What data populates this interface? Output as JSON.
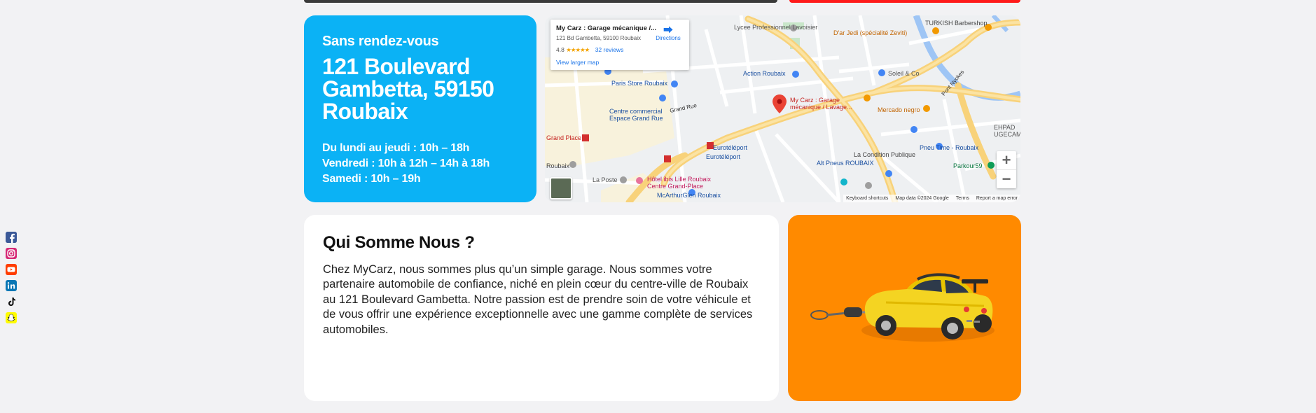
{
  "colors": {
    "info_card_bg": "#0bb2f5",
    "car_card_bg": "#ff8a00",
    "page_bg": "#f2f2f4"
  },
  "social": [
    {
      "name": "facebook-icon"
    },
    {
      "name": "instagram-icon"
    },
    {
      "name": "youtube-icon"
    },
    {
      "name": "linkedin-icon"
    },
    {
      "name": "tiktok-icon"
    },
    {
      "name": "snapchat-icon"
    }
  ],
  "info": {
    "subtitle": "Sans rendez-vous",
    "address": "121 Boulevard Gambetta, 59150 Roubaix",
    "hours": [
      "Du lundi au jeudi : 10h – 18h",
      "Vendredi : 10h à 12h – 14h à 18h",
      "Samedi : 10h – 19h"
    ]
  },
  "map": {
    "place_name": "My Carz : Garage mécanique /...",
    "place_address": "121 Bd Gambetta, 59100 Roubaix",
    "rating": "4.8",
    "stars": "★★★★★",
    "reviews": "32 reviews",
    "directions": "Directions",
    "larger_map": "View larger map",
    "zoom_in": "+",
    "zoom_out": "−",
    "footer": [
      "Keyboard shortcuts",
      "Map data ©2024 Google",
      "Terms",
      "Report a map error"
    ],
    "labels": {
      "lycee": "Lycee Professionnel Lavoisier",
      "jedi": "D'ar Jedi (spécialité Zeviti)",
      "turkish": "TURKISH Barbershop",
      "paris_store": "Paris Store Roubaix",
      "action": "Action Roubaix",
      "soleil": "Soleil & Co",
      "mycarz": "My Carz : Garage mécanique / Lavage...",
      "mercado": "Mercado negro",
      "centre": "Centre commercial Espace Grand Rue",
      "grand_place": "Grand Place",
      "euroteleport": "Eurotéléport",
      "pneu": "Pneu Time - Roubaix",
      "condition": "La Condition Publique",
      "parkour": "Parkour59",
      "alt_pneus": "Alt Pneus ROUBAIX",
      "la_poste": "La Poste",
      "ibis": "Hôtel ibis Lille Roubaix Centre Grand-Place",
      "mcarthur": "McArthurGlen Roubaix",
      "ehpad": "EHPAD UGECAM",
      "grand_rue": "Grand Rue",
      "roubaix": "Roubaix",
      "pont": "Pont Nyckes"
    }
  },
  "about": {
    "title": "Qui Somme Nous ?",
    "text": "Chez MyCarz, nous sommes plus qu’un simple garage. Nous sommes votre partenaire automobile de confiance, niché en plein cœur du centre-ville de Roubaix au 121 Boulevard Gambetta. Notre passion est de prendre soin de votre véhicule et de vous offrir une expérience exceptionnelle avec une gamme complète de services automobiles."
  }
}
